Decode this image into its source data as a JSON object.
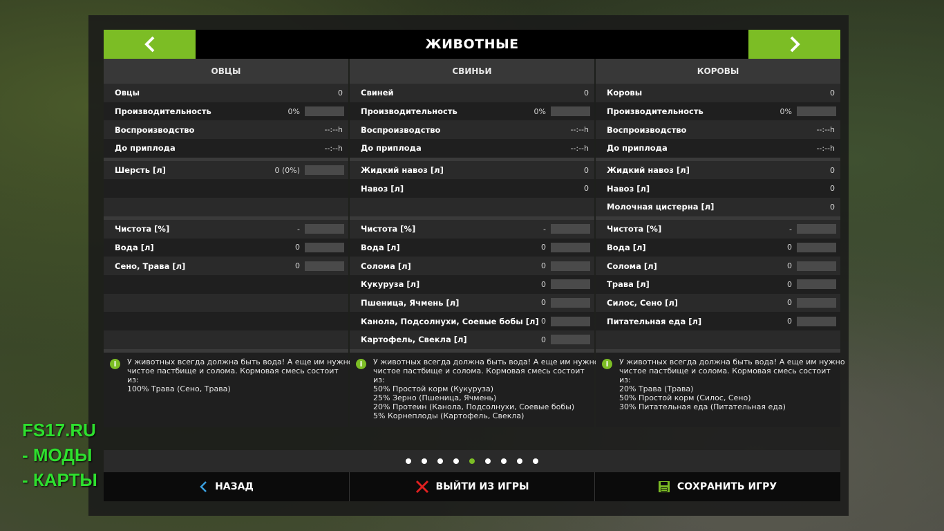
{
  "title": "ЖИВОТНЫЕ",
  "colors": {
    "accent": "#7cbd25"
  },
  "columns": [
    {
      "header": "ОВЦЫ",
      "stats": [
        {
          "label": "Овцы",
          "value": "0",
          "bar": false
        },
        {
          "label": "Производительность",
          "value": "0%",
          "bar": true
        },
        {
          "label": "Воспроизводство",
          "value": "--:--h",
          "bar": false
        },
        {
          "label": "До приплода",
          "value": "--:--h",
          "bar": false
        }
      ],
      "products": [
        {
          "label": "Шерсть [л]",
          "value": "0 (0%)",
          "bar": true
        },
        {
          "label": "",
          "value": "",
          "bar": false
        },
        {
          "label": "",
          "value": "",
          "bar": false
        }
      ],
      "needs": [
        {
          "label": "Чистота [%]",
          "value": "-",
          "bar": true
        },
        {
          "label": "Вода [л]",
          "value": "0",
          "bar": true
        },
        {
          "label": "Сено, Трава [л]",
          "value": "0",
          "bar": true
        },
        {
          "label": "",
          "value": "",
          "bar": false
        },
        {
          "label": "",
          "value": "",
          "bar": false
        },
        {
          "label": "",
          "value": "",
          "bar": false
        },
        {
          "label": "",
          "value": "",
          "bar": false
        }
      ],
      "info": [
        "У животных всегда должна быть вода! А еще им нужно",
        "чистое пастбище и солома. Кормовая смесь состоит",
        "из:",
        "100% Трава (Сено, Трава)"
      ]
    },
    {
      "header": "СВИНЬИ",
      "stats": [
        {
          "label": "Свиней",
          "value": "0",
          "bar": false
        },
        {
          "label": "Производительность",
          "value": "0%",
          "bar": true
        },
        {
          "label": "Воспроизводство",
          "value": "--:--h",
          "bar": false
        },
        {
          "label": "До приплода",
          "value": "--:--h",
          "bar": false
        }
      ],
      "products": [
        {
          "label": "Жидкий навоз [л]",
          "value": "0",
          "bar": false
        },
        {
          "label": "Навоз [л]",
          "value": "0",
          "bar": false
        },
        {
          "label": "",
          "value": "",
          "bar": false
        }
      ],
      "needs": [
        {
          "label": "Чистота [%]",
          "value": "-",
          "bar": true
        },
        {
          "label": "Вода [л]",
          "value": "0",
          "bar": true
        },
        {
          "label": "Солома [л]",
          "value": "0",
          "bar": true
        },
        {
          "label": "Кукуруза [л]",
          "value": "0",
          "bar": true
        },
        {
          "label": "Пшеница, Ячмень [л]",
          "value": "0",
          "bar": true
        },
        {
          "label": "Канола, Подсолнухи, Соевые бобы [л]",
          "value": "0",
          "bar": true
        },
        {
          "label": "Картофель, Свекла [л]",
          "value": "0",
          "bar": true
        }
      ],
      "info": [
        "У животных всегда должна быть вода! А еще им нужно",
        "чистое пастбище и солома. Кормовая смесь состоит",
        "из:",
        "50% Простой корм (Кукуруза)",
        "25% Зерно (Пшеница, Ячмень)",
        "20% Протеин (Канола, Подсолнухи, Соевые бобы)",
        "5% Корнеплоды (Картофель, Свекла)"
      ]
    },
    {
      "header": "КОРОВЫ",
      "stats": [
        {
          "label": "Коровы",
          "value": "0",
          "bar": false
        },
        {
          "label": "Производительность",
          "value": "0%",
          "bar": true
        },
        {
          "label": "Воспроизводство",
          "value": "--:--h",
          "bar": false
        },
        {
          "label": "До приплода",
          "value": "--:--h",
          "bar": false
        }
      ],
      "products": [
        {
          "label": "Жидкий навоз [л]",
          "value": "0",
          "bar": false
        },
        {
          "label": "Навоз [л]",
          "value": "0",
          "bar": false
        },
        {
          "label": "Молочная цистерна [л]",
          "value": "0",
          "bar": false
        }
      ],
      "needs": [
        {
          "label": "Чистота [%]",
          "value": "-",
          "bar": true
        },
        {
          "label": "Вода [л]",
          "value": "0",
          "bar": true
        },
        {
          "label": "Солома [л]",
          "value": "0",
          "bar": true
        },
        {
          "label": "Трава [л]",
          "value": "0",
          "bar": true
        },
        {
          "label": "Силос, Сено [л]",
          "value": "0",
          "bar": true
        },
        {
          "label": "Питательная еда [л]",
          "value": "0",
          "bar": true
        },
        {
          "label": "",
          "value": "",
          "bar": false
        }
      ],
      "info": [
        "У животных всегда должна быть вода! А еще им нужно",
        "чистое пастбище и солома. Кормовая смесь состоит",
        "из:",
        "20% Трава (Трава)",
        "50% Простой корм (Силос, Сено)",
        "30% Питательная еда (Питательная еда)"
      ]
    }
  ],
  "pager": {
    "count": 9,
    "active_index": 4
  },
  "footer": {
    "back": "НАЗАД",
    "quit": "ВЫЙТИ ИЗ ИГРЫ",
    "save": "СОХРАНИТЬ ИГРУ"
  },
  "watermark": [
    "FS17.RU",
    " - МОДЫ",
    " - КАРТЫ"
  ]
}
